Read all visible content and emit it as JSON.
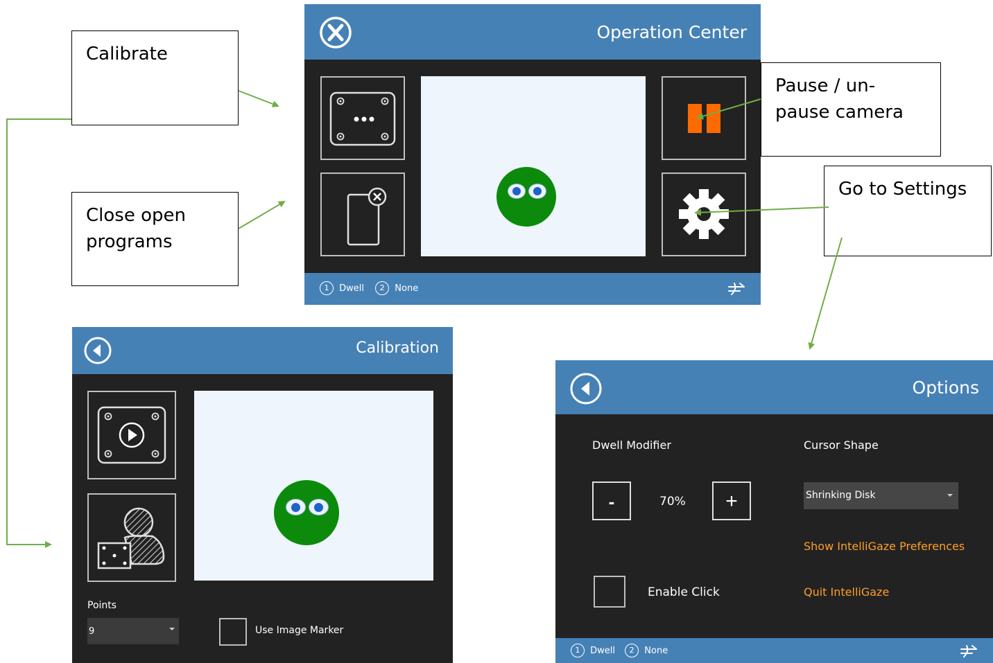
{
  "operation_center": {
    "title": "Operation Center",
    "close_icon": "close-x-circle-icon",
    "tiles": {
      "calibrate_icon": "calibration-grid-icon",
      "close_programs_icon": "close-programs-icon",
      "pause_icon": "pause-icon",
      "settings_icon": "gear-icon"
    },
    "footer": {
      "mode1_num": "1",
      "mode1_label": "Dwell",
      "mode2_num": "2",
      "mode2_label": "None",
      "right_icon": "gaze-hand-icon"
    }
  },
  "callouts": {
    "calibrate": "Calibrate",
    "close_programs": "Close open programs",
    "pause": "Pause / un-pause camera",
    "settings": "Go to Settings"
  },
  "calibration": {
    "title": "Calibration",
    "back_icon": "back-arrow-icon",
    "play_tile_icon": "calibration-play-icon",
    "user_tile_icon": "user-calibration-icon",
    "points_label": "Points",
    "points_value": "9",
    "image_marker_label": "Use Image Marker"
  },
  "options": {
    "title": "Options",
    "back_icon": "back-arrow-icon",
    "dwell_modifier_label": "Dwell Modifier",
    "minus_label": "-",
    "dwell_value": "70%",
    "plus_label": "+",
    "cursor_shape_label": "Cursor Shape",
    "cursor_shape_value": "Shrinking Disk",
    "show_preferences": "Show IntelliGaze Preferences",
    "enable_click_label": "Enable Click",
    "quit": "Quit IntelliGaze",
    "footer": {
      "mode1_num": "1",
      "mode1_label": "Dwell",
      "mode2_num": "2",
      "mode2_label": "None"
    }
  },
  "colors": {
    "header_blue": "#4681b6",
    "panel_dark": "#222222",
    "accent_orange": "#ff9e2a",
    "pause_orange": "#ff6a00",
    "face_green": "#0c8a0c",
    "arrow_green": "#70ad47"
  }
}
